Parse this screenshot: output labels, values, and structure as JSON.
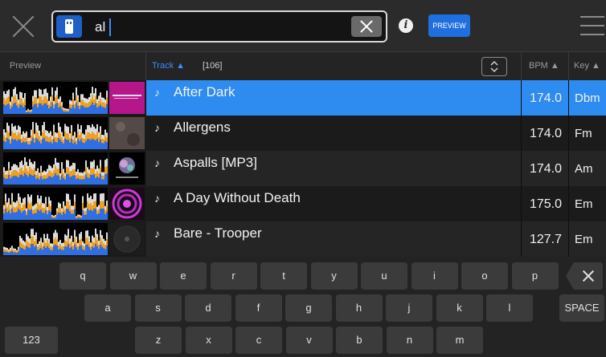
{
  "search": {
    "value": "al"
  },
  "toolbar": {
    "info_label": "i",
    "preview_label": "PREVIEW"
  },
  "columns": {
    "preview": "Preview",
    "track": "Track ▲",
    "count": "[106]",
    "bpm": "BPM ▲",
    "key": "Key ▲"
  },
  "tracks": [
    {
      "title": "After Dark",
      "bpm": "174.0",
      "key": "Dbm",
      "selected": true
    },
    {
      "title": "Allergens",
      "bpm": "174.0",
      "key": "Fm",
      "selected": false
    },
    {
      "title": "Aspalls [MP3]",
      "bpm": "174.0",
      "key": "Am",
      "selected": false
    },
    {
      "title": "A Day Without Death",
      "bpm": "175.0",
      "key": "Em",
      "selected": false
    },
    {
      "title": "Bare - Trooper",
      "bpm": "127.7",
      "key": "Em",
      "selected": false
    }
  ],
  "track_note_glyph": "♪",
  "keyboard": {
    "row1": [
      "q",
      "w",
      "e",
      "r",
      "t",
      "y",
      "u",
      "i",
      "o",
      "p"
    ],
    "row2": [
      "a",
      "s",
      "d",
      "f",
      "g",
      "h",
      "j",
      "k",
      "l"
    ],
    "row3": [
      "z",
      "x",
      "c",
      "v",
      "b",
      "n",
      "m"
    ],
    "space_label": "SPACE",
    "numbers_label": "123"
  },
  "colors": {
    "accent": "#2e8cf0",
    "waveform_blue": "#2f6fe6",
    "waveform_orange": "#f0a01e",
    "waveform_white": "#f4f4f4"
  }
}
